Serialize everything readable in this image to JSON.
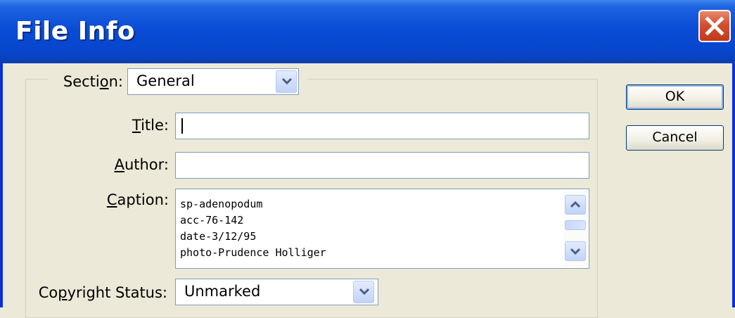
{
  "window": {
    "title": "File Info",
    "close_icon": "close-icon"
  },
  "section": {
    "label_pre": "Secti",
    "label_key": "o",
    "label_post": "n:",
    "value": "General"
  },
  "title_field": {
    "label_key": "T",
    "label_post": "itle:",
    "value": ""
  },
  "author_field": {
    "label_key": "A",
    "label_post": "uthor:",
    "value": ""
  },
  "caption_field": {
    "label_key": "C",
    "label_post": "aption:",
    "lines": [
      "sp-adenopodum",
      "acc-76-142",
      "date-3/12/95",
      "photo-Prudence Holliger"
    ]
  },
  "copyright": {
    "label_pre": "Co",
    "label_key": "p",
    "label_post": "yright Status:",
    "value": "Unmarked"
  },
  "buttons": {
    "ok": "OK",
    "cancel": "Cancel"
  },
  "colors": {
    "titlebar": "#0a4cd6",
    "close": "#d2502f",
    "dialog_bg": "#ece9d8"
  }
}
